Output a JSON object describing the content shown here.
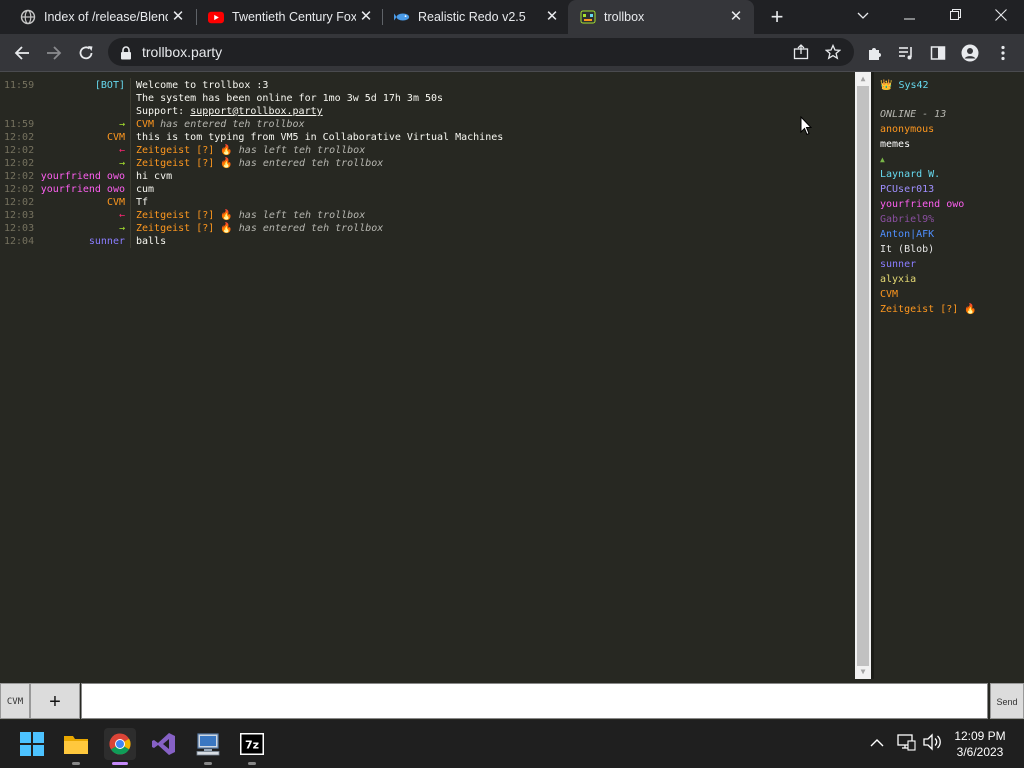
{
  "browser": {
    "tabs": [
      {
        "title": "Index of /release/Blend",
        "favicon": "globe-icon"
      },
      {
        "title": "Twentieth Century Fox",
        "favicon": "youtube-icon"
      },
      {
        "title": "Realistic Redo v2.5",
        "favicon": "fish-icon"
      },
      {
        "title": "trollbox",
        "favicon": "trollbox-icon",
        "active": true
      }
    ],
    "url": "trollbox.party"
  },
  "chat": {
    "messages": [
      {
        "time": "11:59",
        "nick": "[BOT]",
        "nick_color": "#66d9ef",
        "text": "Welcome to trollbox :3"
      },
      {
        "time": "",
        "nick": "",
        "text": "The system has been online for 1mo 3w 5d 17h 3m 50s"
      },
      {
        "time": "",
        "nick": "",
        "text_prefix": "Support: ",
        "link": "support@trollbox.party"
      },
      {
        "time": "11:59",
        "arrow": "→",
        "arrow_color": "#a6e22e",
        "user": "CVM",
        "user_color": "#fd971f",
        "action": "has entered teh trollbox"
      },
      {
        "time": "12:02",
        "nick": "CVM",
        "nick_color": "#fd971f",
        "text": "this is tom typing from VM5 in Collaborative Virtual Machines"
      },
      {
        "time": "12:02",
        "arrow": "←",
        "arrow_color": "#f92672",
        "user": "Zeitgeist [?] 🔥",
        "user_color": "#fd971f",
        "action": "has left teh trollbox"
      },
      {
        "time": "12:02",
        "arrow": "→",
        "arrow_color": "#a6e22e",
        "user": "Zeitgeist [?] 🔥",
        "user_color": "#fd971f",
        "action": "has entered teh trollbox"
      },
      {
        "time": "12:02",
        "nick": "yourfriend owo",
        "nick_color": "#fd5ff0",
        "text": "hi cvm"
      },
      {
        "time": "12:02",
        "nick": "yourfriend owo",
        "nick_color": "#fd5ff0",
        "text": "cum"
      },
      {
        "time": "12:02",
        "nick": "CVM",
        "nick_color": "#fd971f",
        "text": "Tf"
      },
      {
        "time": "12:03",
        "arrow": "←",
        "arrow_color": "#f92672",
        "user": "Zeitgeist [?] 🔥",
        "user_color": "#fd971f",
        "action": "has left teh trollbox"
      },
      {
        "time": "12:03",
        "arrow": "→",
        "arrow_color": "#a6e22e",
        "user": "Zeitgeist [?] 🔥",
        "user_color": "#fd971f",
        "action": "has entered teh trollbox"
      },
      {
        "time": "12:04",
        "nick": "sunner",
        "nick_color": "#8a7dff",
        "text": "balls"
      }
    ]
  },
  "sidebar": {
    "top_user": "👑 Sys42",
    "top_user_color": "#66d9ef",
    "online_label": "ONLINE - 13",
    "users": [
      {
        "name": "anonymous",
        "color": "#fd971f"
      },
      {
        "name": "memes",
        "color": "#ffffff"
      },
      {
        "name": "▲",
        "color": "#7ab648"
      },
      {
        "name": "Laynard W.",
        "color": "#66d9ef"
      },
      {
        "name": "PCUser013",
        "color": "#9f8fff"
      },
      {
        "name": "yourfriend owo",
        "color": "#fd5ff0"
      },
      {
        "name": "Gabriel9%",
        "color": "#8a4fa0"
      },
      {
        "name": "Anton|AFK",
        "color": "#4f8fff"
      },
      {
        "name": "It (Blob)",
        "color": "#e6e6e6"
      },
      {
        "name": "sunner",
        "color": "#8a7dff"
      },
      {
        "name": "alyxia",
        "color": "#e6db74"
      },
      {
        "name": "CVM",
        "color": "#fd971f"
      },
      {
        "name": "Zeitgeist [?] 🔥",
        "color": "#fd971f"
      }
    ]
  },
  "input": {
    "nick_label": "CVM",
    "plus_label": "+",
    "placeholder": "",
    "send_label": "Send"
  },
  "taskbar": {
    "time": "12:09 PM",
    "date": "3/6/2023",
    "pinned": [
      "windows-start-icon",
      "file-explorer-icon",
      "chrome-icon",
      "visual-studio-icon",
      "remote-desktop-icon",
      "7zip-icon"
    ]
  }
}
